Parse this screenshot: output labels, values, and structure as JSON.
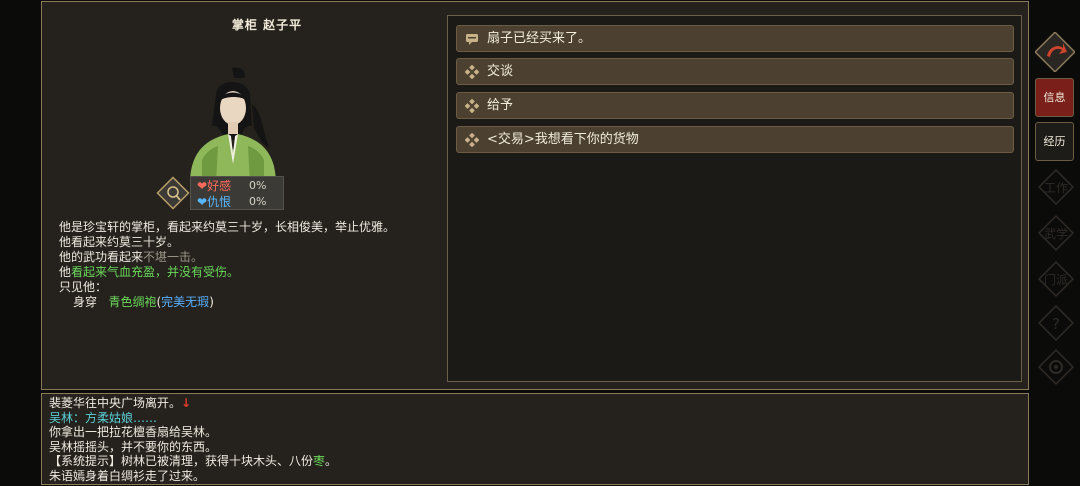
{
  "npc": {
    "title": "掌柜 赵子平",
    "relations": [
      {
        "label": "好感",
        "value": "0%",
        "color": "#ff6a5a"
      },
      {
        "label": "仇恨",
        "value": "0%",
        "color": "#58b8ff"
      }
    ],
    "description": {
      "line1": "他是珍宝轩的掌柜，看起来约莫三十岁，长相俊美，举止优雅。",
      "line2": "他看起来约莫三十岁。",
      "line3_prefix": "他的武功看起来",
      "line3_grey": "不堪一击。",
      "line4_prefix": "他",
      "line4_green": "看起来气血充盈，并没有受伤。",
      "line5": "只见他：",
      "wear_prefix": "身穿",
      "wear_item": "青色绸袍",
      "wear_cond_open": "(",
      "wear_cond": "完美无瑕",
      "wear_cond_close": ")"
    }
  },
  "options": [
    {
      "label": "扇子已经买来了。",
      "icon": "chat-bubble-icon"
    },
    {
      "label": "交谈",
      "icon": "diamond-ornament-icon"
    },
    {
      "label": "给予",
      "icon": "diamond-ornament-icon"
    },
    {
      "label": "<交易>我想看下你的货物",
      "icon": "diamond-ornament-icon"
    }
  ],
  "log": {
    "l1": "裴菱华往中央广场离开。",
    "l1_arrow": "↓",
    "l2": "吴林：方柔姑娘……",
    "l3": "你拿出一把拉花檀香扇给吴林。",
    "l4": "吴林摇摇头，并不要你的东西。",
    "l5_prefix": "【系统提示】树林已被清理，获得十块木头、八份",
    "l5_item": "枣",
    "l5_suffix": "。",
    "l6": "朱语嫣身着白绸衫走了过来。"
  },
  "sidebar": {
    "info": "信息",
    "history": "经历",
    "ghost_buttons": [
      "工作",
      "武学",
      "门派",
      "?",
      "设置"
    ]
  },
  "colors": {
    "accent": "#7a1f1a",
    "panel": "#25221d",
    "border": "#8a7a5a"
  }
}
